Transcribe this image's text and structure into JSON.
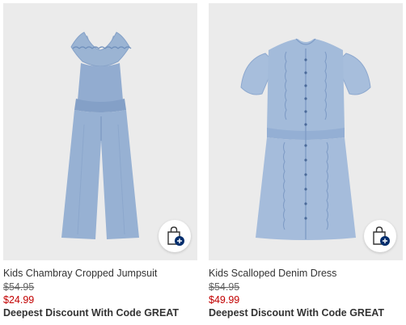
{
  "products": [
    {
      "name": "Kids Chambray Cropped Jumpsuit",
      "original_price": "$54.95",
      "sale_price": "$24.99",
      "promo": "Deepest Discount With Code GREAT",
      "image_icon": "jumpsuit-image",
      "bag_icon": "add-to-bag-icon"
    },
    {
      "name": "Kids Scalloped Denim Dress",
      "original_price": "$54.95",
      "sale_price": "$49.99",
      "promo": "Deepest Discount With Code GREAT",
      "image_icon": "dress-image",
      "bag_icon": "add-to-bag-icon"
    }
  ],
  "colors": {
    "image_background": "#ebebeb",
    "sale_price": "#c20000",
    "bag_badge": "#002e6d",
    "denim_light": "#9bb4d3",
    "denim_mid": "#7e9dc4"
  }
}
